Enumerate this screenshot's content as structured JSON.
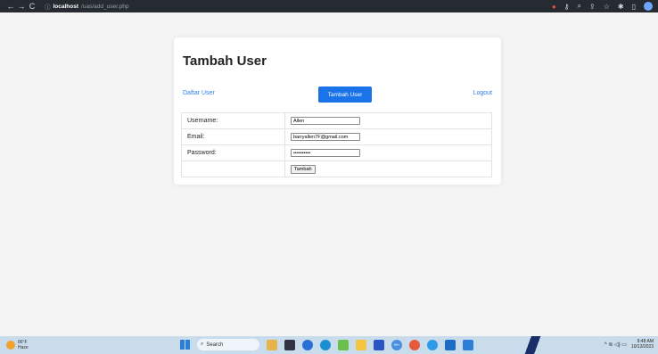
{
  "browser": {
    "nav_back": "←",
    "nav_forward": "→",
    "nav_reload": "C",
    "info_icon": "ⓘ",
    "host": "localhost",
    "path": "/uas/add_user.php",
    "icons": [
      "color-icon",
      "key-icon",
      "zoom-icon",
      "share-icon",
      "star-icon",
      "extensions-icon",
      "sidepanel-icon",
      "avatar"
    ]
  },
  "page": {
    "title": "Tambah User",
    "nav": {
      "left_link": "Daftar User",
      "primary_button": "Tambah User",
      "right_link": "Logout"
    },
    "form": {
      "rows": [
        {
          "label": "Username:",
          "value": "Allen"
        },
        {
          "label": "Email:",
          "value": "barryallen7F@gmail.com"
        },
        {
          "label": "Password:",
          "value": "••••••••••"
        }
      ],
      "submit_label": "Tambah"
    }
  },
  "taskbar": {
    "weather_temp": "86°F",
    "weather_desc": "Haze",
    "search_label": "Search",
    "search_icon": "⌕",
    "badge_count": "99+",
    "time": "9:48 AM",
    "date": "10/13/2023",
    "tray_symbols": "^  ≋  ◁)  ▭"
  },
  "colors": {
    "accent": "#1a73e8",
    "link": "#2f80ed",
    "chrome": "#262a31",
    "taskbar": "#c9dceb"
  }
}
